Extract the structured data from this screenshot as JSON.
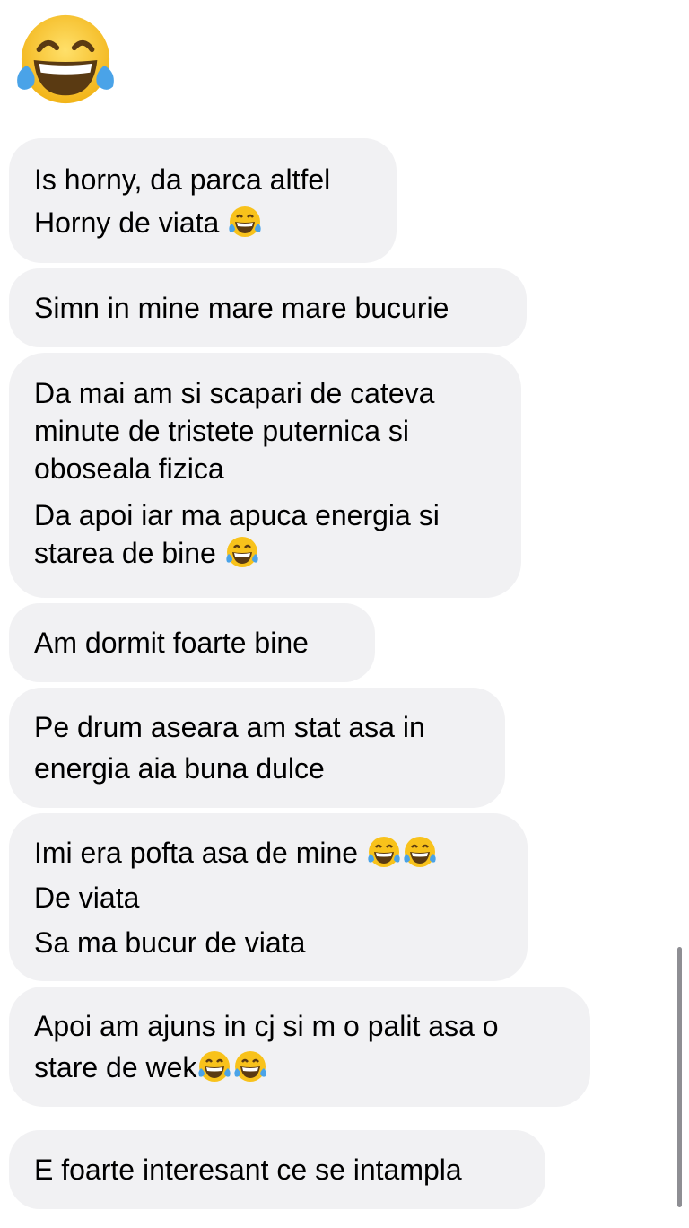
{
  "reaction_emoji": "face-with-tears-of-joy-icon",
  "colors": {
    "bubble_bg": "#f1f1f3",
    "text": "#000000",
    "emoji_face": "#f8c21b",
    "emoji_tears": "#4aa3e8",
    "scrollbar": "#8e8e93"
  },
  "messages": [
    {
      "lines": [
        "Is horny, da parca altfel",
        "Horny de viata"
      ]
    },
    {
      "lines": [
        "Simn in mine mare mare bucurie"
      ]
    },
    {
      "lines": [
        "Da mai am si scapari de cateva",
        "minute de tristete puternica si",
        "oboseala fizica",
        "Da apoi iar ma apuca energia si",
        "starea de bine"
      ]
    },
    {
      "lines": [
        "Am dormit foarte bine"
      ]
    },
    {
      "lines": [
        "Pe drum aseara am stat asa in",
        "energia aia buna dulce"
      ]
    },
    {
      "lines": [
        "Imi era pofta asa de mine",
        "De viata",
        "Sa ma bucur de viata"
      ]
    },
    {
      "lines": [
        "Apoi am ajuns in cj si m o palit asa o",
        "stare de wek"
      ]
    },
    {
      "lines": [
        "E foarte interesant ce se intampla"
      ]
    }
  ]
}
